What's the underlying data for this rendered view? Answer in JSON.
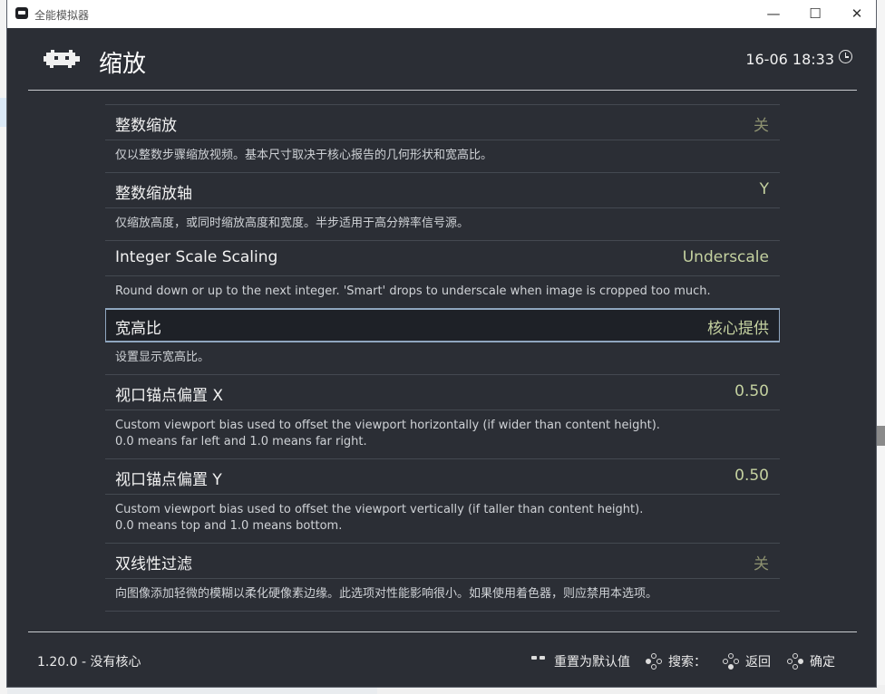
{
  "window": {
    "title": "全能模拟器",
    "minimize_glyph": "—",
    "maximize_glyph": "☐",
    "close_glyph": "✕"
  },
  "header": {
    "title": "缩放",
    "datetime": "16-06 18:33",
    "logo_icon": "retroarch-invader-icon",
    "clock_icon": "clock-icon"
  },
  "settings": [
    {
      "label": "整数缩放",
      "value": "关",
      "value_state": "off",
      "description": "仅以整数步骤缩放视频。基本尺寸取决于核心报告的几何形状和宽高比。"
    },
    {
      "label": "整数缩放轴",
      "value": "Y",
      "value_state": "on",
      "description": "仅缩放高度，或同时缩放高度和宽度。半步适用于高分辨率信号源。"
    },
    {
      "label": "Integer Scale Scaling",
      "value": "Underscale",
      "value_state": "on",
      "description": "Round down or up to the next integer. 'Smart' drops to underscale when image is cropped too much."
    },
    {
      "label": "宽高比",
      "value": "核心提供",
      "value_state": "on",
      "selected": true,
      "description": "设置显示宽高比。"
    },
    {
      "label": "视口锚点偏置 X",
      "value": "0.50",
      "value_state": "on",
      "description": "Custom viewport bias used to offset the viewport horizontally (if wider than content height).  0.0 means far left and 1.0 means far right."
    },
    {
      "label": "视口锚点偏置 Y",
      "value": "0.50",
      "value_state": "on",
      "description": "Custom viewport bias used to offset the viewport vertically (if taller than content height).  0.0 means top and 1.0 means bottom."
    },
    {
      "label": "双线性过滤",
      "value": "关",
      "value_state": "off",
      "description": "向图像添加轻微的模糊以柔化硬像素边缘。此选项对性能影响很小。如果使用着色器，则应禁用本选项。"
    }
  ],
  "footer": {
    "version": "1.20.0 - 没有核心",
    "hints": {
      "reset": "重置为默认值",
      "search": "搜索：",
      "back": "返回",
      "ok": "确定"
    }
  },
  "colors": {
    "background": "#2b2e35",
    "value_on": "#c4d1a0",
    "value_off": "#8d9170",
    "selection_border": "#8fa6bf"
  }
}
